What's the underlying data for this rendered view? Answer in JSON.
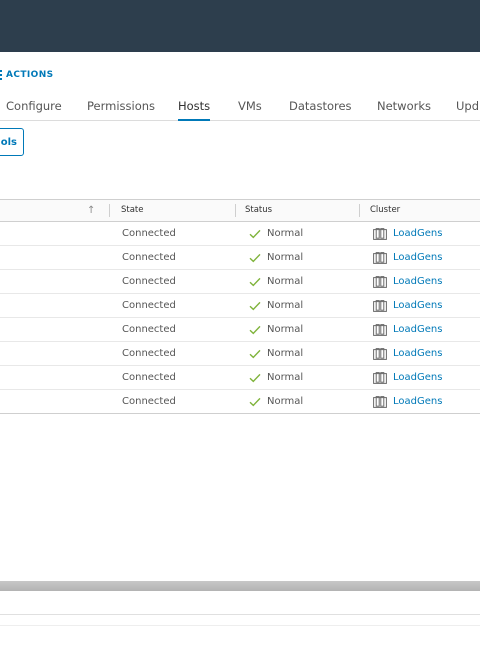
{
  "toolbar": {
    "actions_label": "ACTIONS"
  },
  "tabs": [
    {
      "label": "Configure",
      "active": false
    },
    {
      "label": "Permissions",
      "active": false
    },
    {
      "label": "Hosts",
      "active": true
    },
    {
      "label": "VMs",
      "active": false
    },
    {
      "label": "Datastores",
      "active": false
    },
    {
      "label": "Networks",
      "active": false
    },
    {
      "label": "Upd",
      "active": false
    }
  ],
  "tools_button": {
    "label": "ols"
  },
  "grid": {
    "columns": {
      "sort": "↑",
      "state": "State",
      "status": "Status",
      "cluster": "Cluster"
    },
    "rows": [
      {
        "state": "Connected",
        "status": "Normal",
        "cluster": "LoadGens"
      },
      {
        "state": "Connected",
        "status": "Normal",
        "cluster": "LoadGens"
      },
      {
        "state": "Connected",
        "status": "Normal",
        "cluster": "LoadGens"
      },
      {
        "state": "Connected",
        "status": "Normal",
        "cluster": "LoadGens"
      },
      {
        "state": "Connected",
        "status": "Normal",
        "cluster": "LoadGens"
      },
      {
        "state": "Connected",
        "status": "Normal",
        "cluster": "LoadGens"
      },
      {
        "state": "Connected",
        "status": "Normal",
        "cluster": "LoadGens"
      },
      {
        "state": "Connected",
        "status": "Normal",
        "cluster": "LoadGens"
      }
    ]
  },
  "colors": {
    "accent": "#0079b8",
    "status_ok": "#7fb33b",
    "header_bg": "#2d3e4d"
  }
}
